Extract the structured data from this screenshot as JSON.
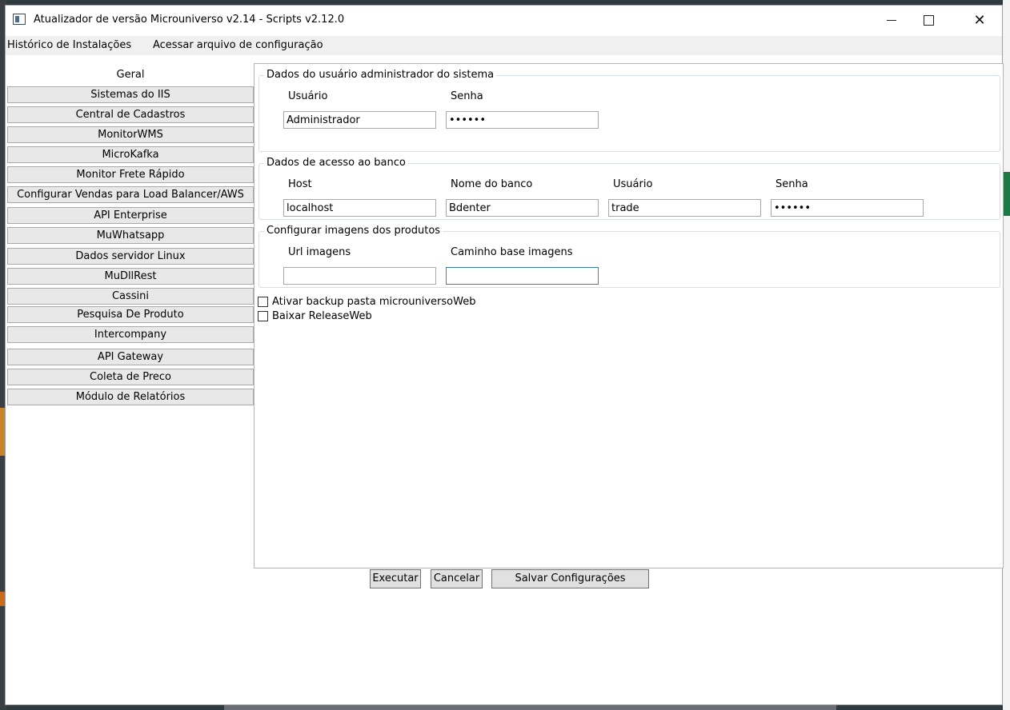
{
  "window": {
    "title": "Atualizador de versão Microuniverso v2.14 - Scripts v2.12.0",
    "minimize_label": "–",
    "maximize_label": "☐",
    "close_label": "✕"
  },
  "menu": {
    "items": [
      {
        "label": "Histórico de Instalações"
      },
      {
        "label": "Acessar arquivo de configuração"
      }
    ]
  },
  "tabs": {
    "selected": "Geral",
    "items": [
      {
        "label": "Geral"
      },
      {
        "label": "Sistemas do IIS"
      },
      {
        "label": "Central de Cadastros"
      },
      {
        "label": "MonitorWMS"
      },
      {
        "label": "MicroKafka"
      },
      {
        "label": "Monitor Frete Rápido"
      },
      {
        "label": "Configurar Vendas para Load Balancer/AWS"
      },
      {
        "label": "API Enterprise"
      },
      {
        "label": "MuWhatsapp"
      },
      {
        "label": "Dados servidor Linux"
      },
      {
        "label": "MuDllRest"
      },
      {
        "label": "Cassini"
      },
      {
        "label": "Pesquisa De Produto"
      },
      {
        "label": "Intercompany"
      },
      {
        "label": "API Gateway"
      },
      {
        "label": "Coleta de Preco"
      },
      {
        "label": "Módulo de Relatórios"
      }
    ]
  },
  "admin_group": {
    "title": "Dados do usuário administrador do sistema",
    "user_label": "Usuário",
    "user_value": "Administrador",
    "password_label": "Senha",
    "password_value": "••••••"
  },
  "db_group": {
    "title": "Dados de acesso ao banco",
    "host_label": "Host",
    "host_value": "localhost",
    "dbname_label": "Nome do banco",
    "dbname_value": "Bdenter",
    "user_label": "Usuário",
    "user_value": "trade",
    "password_label": "Senha",
    "password_value": "••••••"
  },
  "images_group": {
    "title": "Configurar imagens dos produtos",
    "url_label": "Url imagens",
    "url_value": "",
    "path_label": "Caminho base imagens",
    "path_value": ""
  },
  "checkboxes": [
    {
      "label": "Ativar backup pasta microuniversoWeb",
      "checked": false
    },
    {
      "label": "Baixar ReleaseWeb",
      "checked": false
    }
  ],
  "buttons": {
    "execute": "Executar",
    "cancel": "Cancelar",
    "save": "Salvar Configurações"
  }
}
